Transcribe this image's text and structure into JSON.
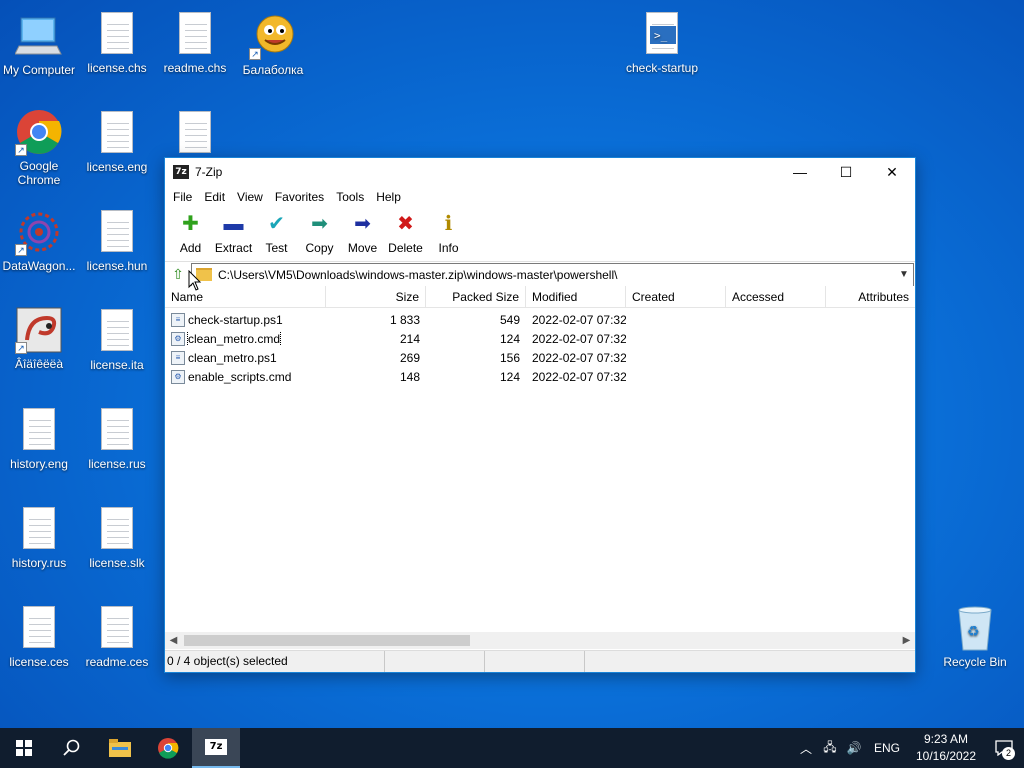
{
  "desktop": {
    "icons": [
      {
        "label": "My Computer",
        "icon": "computer-icon"
      },
      {
        "label": "license.chs",
        "icon": "document-icon"
      },
      {
        "label": "readme.chs",
        "icon": "document-icon"
      },
      {
        "label": "Балаболка",
        "icon": "balabolka-icon"
      },
      {
        "label": "check-startup",
        "icon": "powershell-script-icon"
      },
      {
        "label": "Google Chrome",
        "icon": "chrome-icon"
      },
      {
        "label": "license.eng",
        "icon": "document-icon"
      },
      {
        "label": "DataWagon...",
        "icon": "datawagon-icon"
      },
      {
        "label": "license.hun",
        "icon": "document-icon"
      },
      {
        "label": "Âîäîêëëà",
        "icon": "app-icon"
      },
      {
        "label": "license.ita",
        "icon": "document-icon"
      },
      {
        "label": "history.eng",
        "icon": "document-icon"
      },
      {
        "label": "license.rus",
        "icon": "document-icon"
      },
      {
        "label": "history.rus",
        "icon": "document-icon"
      },
      {
        "label": "license.slk",
        "icon": "document-icon"
      },
      {
        "label": "license.ces",
        "icon": "document-icon"
      },
      {
        "label": "readme.ces",
        "icon": "document-icon"
      },
      {
        "label": "Recycle Bin",
        "icon": "recycle-bin-icon"
      }
    ]
  },
  "window": {
    "title": "7-Zip",
    "app_icon_text": "7z",
    "controls": {
      "minimize": "—",
      "maximize": "☐",
      "close": "✕"
    },
    "menu": [
      "File",
      "Edit",
      "View",
      "Favorites",
      "Tools",
      "Help"
    ],
    "toolbar": [
      {
        "label": "Add",
        "icon": "add-icon",
        "glyph": "✚",
        "color": "#2fa11c"
      },
      {
        "label": "Extract",
        "icon": "extract-icon",
        "glyph": "▬",
        "color": "#1e3aa8"
      },
      {
        "label": "Test",
        "icon": "test-icon",
        "glyph": "✔",
        "color": "#1aa6b8"
      },
      {
        "label": "Copy",
        "icon": "copy-icon",
        "glyph": "➡",
        "color": "#1f8f7a"
      },
      {
        "label": "Move",
        "icon": "move-icon",
        "glyph": "➡",
        "color": "#1e2fa0"
      },
      {
        "label": "Delete",
        "icon": "delete-icon",
        "glyph": "✖",
        "color": "#d01818"
      },
      {
        "label": "Info",
        "icon": "info-icon",
        "glyph": "ℹ",
        "color": "#b08a00"
      }
    ],
    "address": "C:\\Users\\VM5\\Downloads\\windows-master.zip\\windows-master\\powershell\\",
    "columns": [
      "Name",
      "Size",
      "Packed Size",
      "Modified",
      "Created",
      "Accessed",
      "Attributes"
    ],
    "files": [
      {
        "name": "check-startup.ps1",
        "size": "1 833",
        "packed": "549",
        "modified": "2022-02-07 07:32",
        "created": "",
        "accessed": "",
        "attributes": ""
      },
      {
        "name": "clean_metro.cmd",
        "size": "214",
        "packed": "124",
        "modified": "2022-02-07 07:32",
        "created": "",
        "accessed": "",
        "attributes": ""
      },
      {
        "name": "clean_metro.ps1",
        "size": "269",
        "packed": "156",
        "modified": "2022-02-07 07:32",
        "created": "",
        "accessed": "",
        "attributes": ""
      },
      {
        "name": "enable_scripts.cmd",
        "size": "148",
        "packed": "124",
        "modified": "2022-02-07 07:32",
        "created": "",
        "accessed": "",
        "attributes": ""
      }
    ],
    "status": "0 / 4 object(s) selected"
  },
  "taskbar": {
    "items": [
      "start-icon",
      "search-icon",
      "file-explorer-icon",
      "chrome-icon",
      "7zip-icon"
    ],
    "language": "ENG",
    "time": "9:23 AM",
    "date": "10/16/2022",
    "notification_count": "2"
  }
}
